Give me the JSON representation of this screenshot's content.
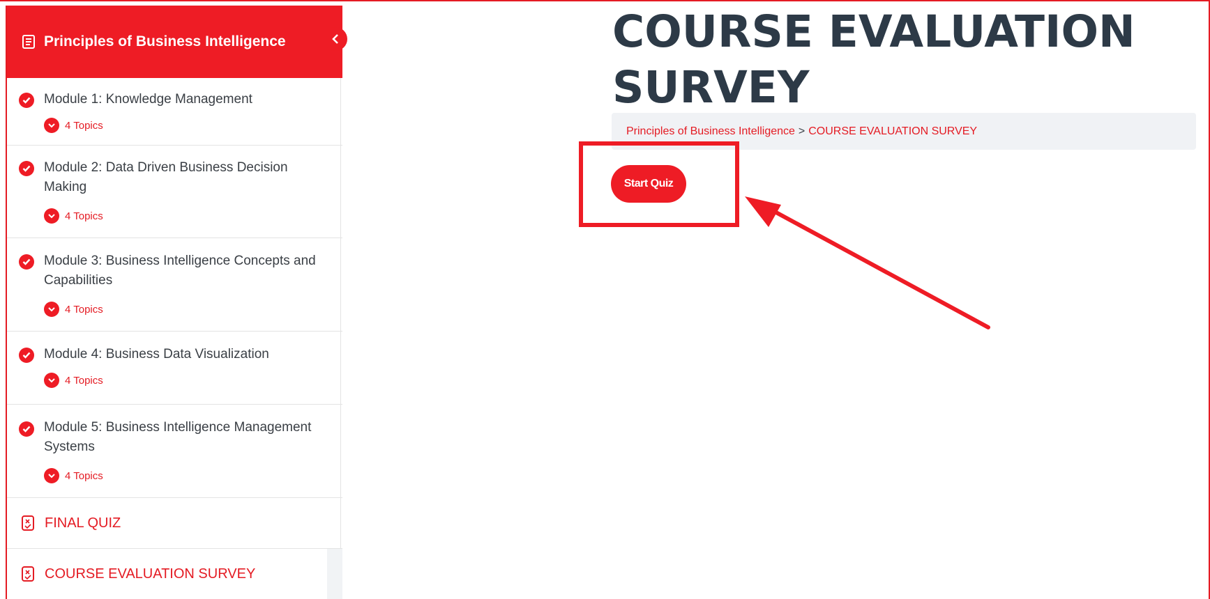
{
  "sidebar": {
    "course_title": "Principles of Business Intelligence",
    "modules": [
      {
        "title": "Module 1: Knowledge Management",
        "topics": "4 Topics"
      },
      {
        "title": "Module 2: Data Driven Business Decision Making",
        "topics": "4 Topics"
      },
      {
        "title": "Module 3: Business Intelligence Concepts and Capabilities",
        "topics": "4 Topics"
      },
      {
        "title": "Module 4: Business Data Visualization",
        "topics": "4 Topics"
      },
      {
        "title": "Module 5: Business Intelligence Management Systems",
        "topics": "4 Topics"
      }
    ],
    "quizzes": [
      {
        "label": "FINAL QUIZ"
      },
      {
        "label": "COURSE EVALUATION SURVEY"
      }
    ]
  },
  "main": {
    "title": "COURSE EVALUATION SURVEY",
    "breadcrumb": {
      "course": "Principles of Business Intelligence",
      "separator": ">",
      "current": "COURSE EVALUATION SURVEY"
    },
    "start_button": "Start Quiz"
  },
  "colors": {
    "accent": "#ee1c25",
    "text": "#2d3a47",
    "breadcrumb_bg": "#f0f2f5"
  },
  "icons": [
    "book-icon",
    "chevron-left-icon",
    "check-circle-icon",
    "chevron-down-icon",
    "quiz-icon"
  ]
}
